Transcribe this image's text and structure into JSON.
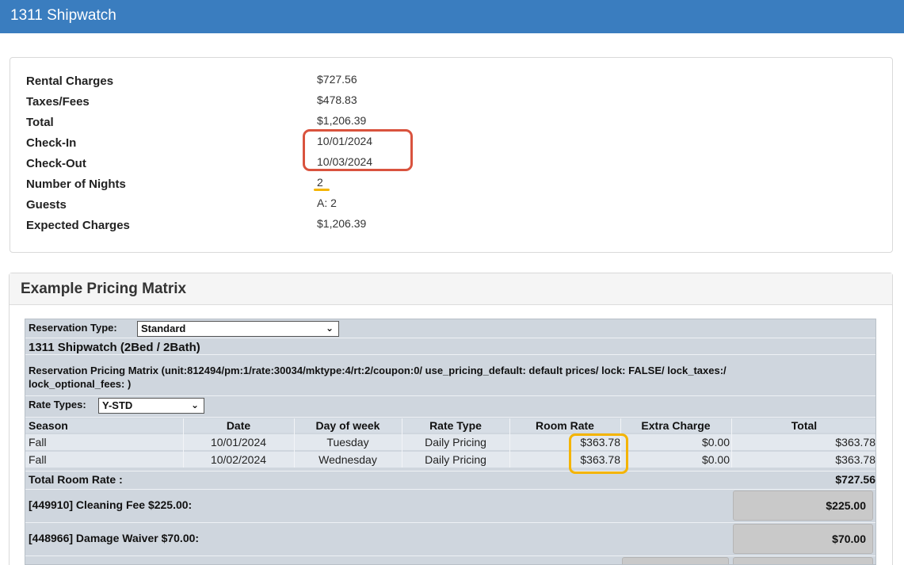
{
  "header": {
    "title": "1311 Shipwatch"
  },
  "summary": {
    "rows": [
      {
        "label": "Rental Charges",
        "value": "$727.56"
      },
      {
        "label": "Taxes/Fees",
        "value": "$478.83"
      },
      {
        "label": "Total",
        "value": "$1,206.39"
      },
      {
        "label": "Check-In",
        "value": "10/01/2024"
      },
      {
        "label": "Check-Out",
        "value": "10/03/2024"
      },
      {
        "label": "Number of Nights",
        "value": "2"
      },
      {
        "label": "Guests",
        "value": "A: 2"
      },
      {
        "label": "Expected Charges",
        "value": "$1,206.39"
      }
    ]
  },
  "highlight_colors": {
    "red": "#d9533e",
    "yellow": "#f4b400"
  },
  "matrix": {
    "title": "Example Pricing Matrix",
    "reservation_type_label": "Reservation Type:",
    "reservation_type_value": "Standard",
    "unit_title": "1311 Shipwatch (2Bed / 2Bath)",
    "pricing_line1": "Reservation Pricing Matrix (unit:812494/pm:1/rate:30034/mktype:4/rt:2/coupon:0/ use_pricing_default: default prices/ lock: FALSE/ lock_taxes:/",
    "pricing_line2": "lock_optional_fees: )",
    "rate_types_label": "Rate Types:",
    "rate_types_value": "Y-STD",
    "columns": [
      "Season",
      "Date",
      "Day of week",
      "Rate Type",
      "Room Rate",
      "Extra Charge",
      "Total"
    ],
    "rows": [
      [
        "Fall",
        "10/01/2024",
        "Tuesday",
        "Daily Pricing",
        "$363.78",
        "$0.00",
        "$363.78"
      ],
      [
        "Fall",
        "10/02/2024",
        "Wednesday",
        "Daily Pricing",
        "$363.78",
        "$0.00",
        "$363.78"
      ]
    ],
    "total_room_rate_label": "Total Room Rate :",
    "total_room_rate_value": "$727.56",
    "fees": [
      {
        "label": "[449910] Cleaning Fee $225.00:",
        "value": "$225.00"
      },
      {
        "label": "[448966] Damage Waiver $70.00:",
        "value": "$70.00"
      }
    ]
  }
}
